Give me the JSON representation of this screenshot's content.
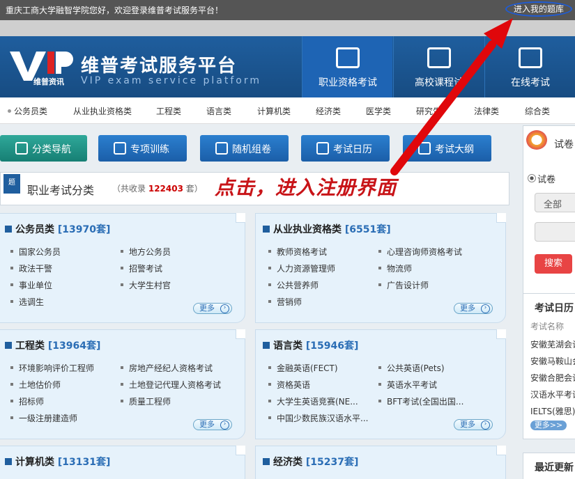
{
  "topbar": {
    "welcome": "重庆工商大学融智学院您好，欢迎登录维普考试服务平台！",
    "enter_link": "进入我的题库"
  },
  "brand": {
    "logo_sub": "维普资讯",
    "title": "维普考试服务平台",
    "subtitle": "VIP exam service platform"
  },
  "nav": [
    {
      "label": "职业资格考试"
    },
    {
      "label": "高校课程试"
    },
    {
      "label": "在线考试"
    }
  ],
  "categories": [
    "公务员类",
    "从业执业资格类",
    "工程类",
    "语言类",
    "计算机类",
    "经济类",
    "医学类",
    "研究生",
    "法律类",
    "综合类"
  ],
  "tabs": [
    "分类导航",
    "专项训练",
    "随机组卷",
    "考试日历",
    "考试大纲"
  ],
  "section": {
    "badge": "题",
    "title": "职业考试分类",
    "count_prefix": "（共收录",
    "count": "122403",
    "count_suffix": "套）"
  },
  "annotation": "点击，进入注册界面",
  "cards": [
    {
      "title": "公务员类",
      "count": "[13970套]",
      "items": [
        "国家公务员",
        "地方公务员",
        "政法干警",
        "招警考试",
        "事业单位",
        "大学生村官",
        "选调生"
      ],
      "more": "更多"
    },
    {
      "title": "从业执业资格类",
      "count": "[6551套]",
      "items": [
        "教师资格考试",
        "心理咨询师资格考试",
        "人力资源管理师",
        "物流师",
        "公共营养师",
        "广告设计师",
        "营销师"
      ],
      "more": "更多"
    },
    {
      "title": "工程类",
      "count": "[13964套]",
      "items": [
        "环境影响评价工程师",
        "房地产经纪人资格考试",
        "土地估价师",
        "土地登记代理人资格考试",
        "招标师",
        "质量工程师",
        "一级注册建造师"
      ],
      "more": "更多"
    },
    {
      "title": "语言类",
      "count": "[15946套]",
      "items": [
        "金融英语(FECT)",
        "公共英语(Pets)",
        "资格英语",
        "英语水平考试",
        "大学生英语竞赛(NE...",
        "BFT考试(全国出国...",
        "中国少数民族汉语水平..."
      ],
      "more": "更多"
    },
    {
      "title": "计算机类",
      "count": "[13131套]",
      "items": [],
      "more": ""
    },
    {
      "title": "经济类",
      "count": "[15237套]",
      "items": [],
      "more": ""
    }
  ],
  "sidebar": {
    "search_title": "试卷",
    "radio_label": "试卷",
    "select_value": "全部",
    "search_button": "搜索",
    "calendar_title": "考试日历",
    "calendar_header": "考试名称",
    "calendar_rows": [
      "安徽芜湖会计",
      "安徽马鞍山会",
      "安徽合肥会计",
      "汉语水平考试",
      "IELTS(雅思)"
    ],
    "calendar_more": "更多>>",
    "recent_title": "最近更新"
  },
  "colors": {
    "header": "#1f5e9e",
    "accent_red": "#c81418",
    "tab_blue": "#2b7fcf",
    "tab_teal": "#2fa89a"
  }
}
